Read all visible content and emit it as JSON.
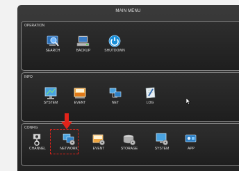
{
  "window": {
    "title": "MAIN MENU"
  },
  "sections": {
    "operation": {
      "label": "OPERATION",
      "items": [
        {
          "label": "SEARCH",
          "icon": "search-icon"
        },
        {
          "label": "BACKUP",
          "icon": "backup-icon"
        },
        {
          "label": "SHUTDOWN",
          "icon": "power-icon"
        }
      ]
    },
    "info": {
      "label": "INFO",
      "items": [
        {
          "label": "SYSTEM",
          "icon": "system-info-icon"
        },
        {
          "label": "EVENT",
          "icon": "event-info-icon"
        },
        {
          "label": "NET",
          "icon": "network-info-icon"
        },
        {
          "label": "LOG",
          "icon": "log-icon"
        }
      ]
    },
    "config": {
      "label": "CONFIG",
      "items": [
        {
          "label": "CHANNEL",
          "icon": "channel-icon"
        },
        {
          "label": "NETWORK",
          "icon": "network-config-icon"
        },
        {
          "label": "EVENT",
          "icon": "event-config-icon"
        },
        {
          "label": "STORAGE",
          "icon": "storage-icon"
        },
        {
          "label": "SYSTEM",
          "icon": "system-config-icon"
        },
        {
          "label": "APP",
          "icon": "app-icon"
        }
      ]
    }
  },
  "highlight": {
    "target": "NETWORK",
    "color": "#e2231a"
  }
}
